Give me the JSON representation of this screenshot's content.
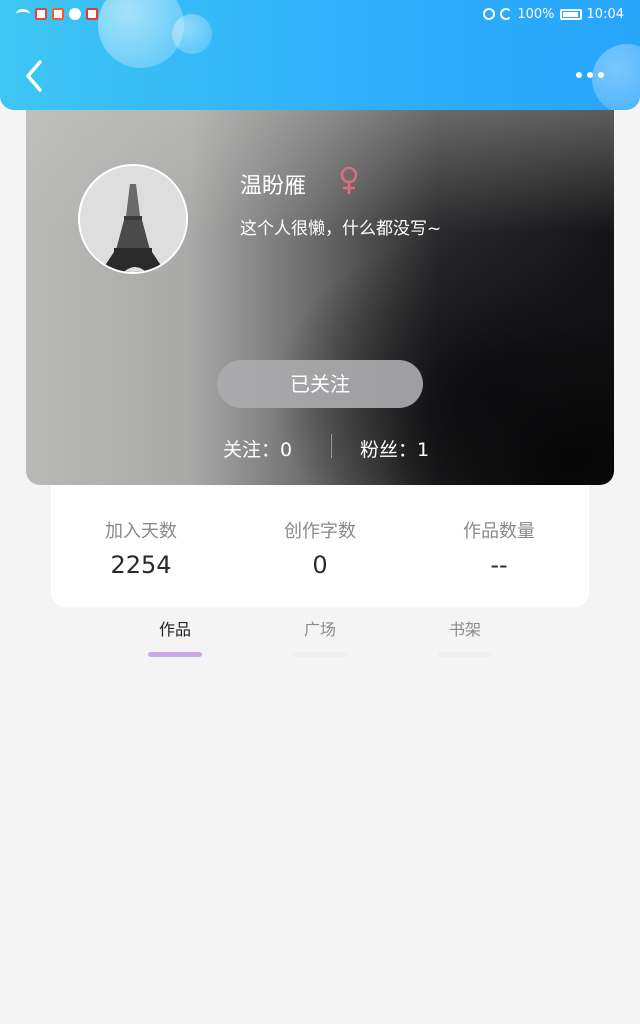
{
  "status_bar": {
    "battery": "100%",
    "time": "10:04"
  },
  "header": {
    "back_icon": "chevron-left-icon",
    "more_icon": "more-dots-icon"
  },
  "profile": {
    "nickname": "温盼雁",
    "gender_icon": "female-icon",
    "gender_color": "#e06c82",
    "bio": "这个人很懒，什么都没写~",
    "follow_button": "已关注",
    "following": "关注：0",
    "fans": "粉丝：1"
  },
  "stats": [
    {
      "label": "加入天数",
      "value": "2254"
    },
    {
      "label": "创作字数",
      "value": "0"
    },
    {
      "label": "作品数量",
      "value": "--"
    }
  ],
  "tabs": [
    {
      "label": "作品",
      "active": true
    },
    {
      "label": "广场",
      "active": false
    },
    {
      "label": "书架",
      "active": false
    }
  ],
  "colors": {
    "header_blue": "#2eaefb",
    "tab_indicator": "#c8abe6",
    "page_bg": "#f4f4f5"
  }
}
